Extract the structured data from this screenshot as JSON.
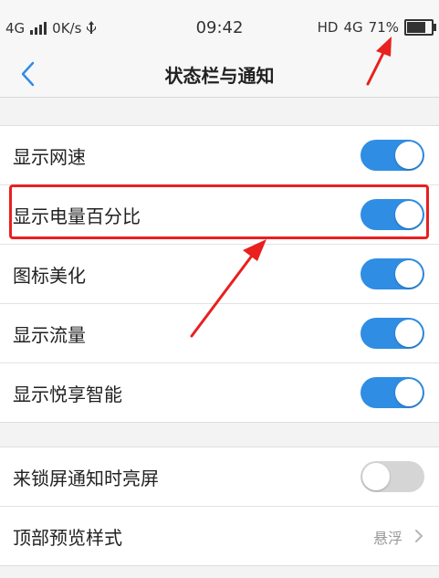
{
  "status_bar": {
    "network_type": "4G",
    "speed": "0K/s",
    "time": "09:42",
    "hd": "HD",
    "net_right": "4G",
    "battery_percent": "71%",
    "battery_level": 0.71
  },
  "nav": {
    "back_icon": "chevron-left-icon",
    "title": "状态栏与通知"
  },
  "group1": {
    "items": [
      {
        "label": "显示网速",
        "enabled": true
      },
      {
        "label": "显示电量百分比",
        "enabled": true
      },
      {
        "label": "图标美化",
        "enabled": true
      },
      {
        "label": "显示流量",
        "enabled": true
      },
      {
        "label": "显示悦享智能",
        "enabled": true
      }
    ]
  },
  "group2": {
    "items": [
      {
        "label": "来锁屏通知时亮屏",
        "enabled": false
      },
      {
        "label": "顶部预览样式",
        "value": "悬浮"
      }
    ]
  },
  "colors": {
    "accent": "#2f8de4",
    "toggle_off": "#d5d5d5",
    "annotation_red": "#e8201f"
  }
}
